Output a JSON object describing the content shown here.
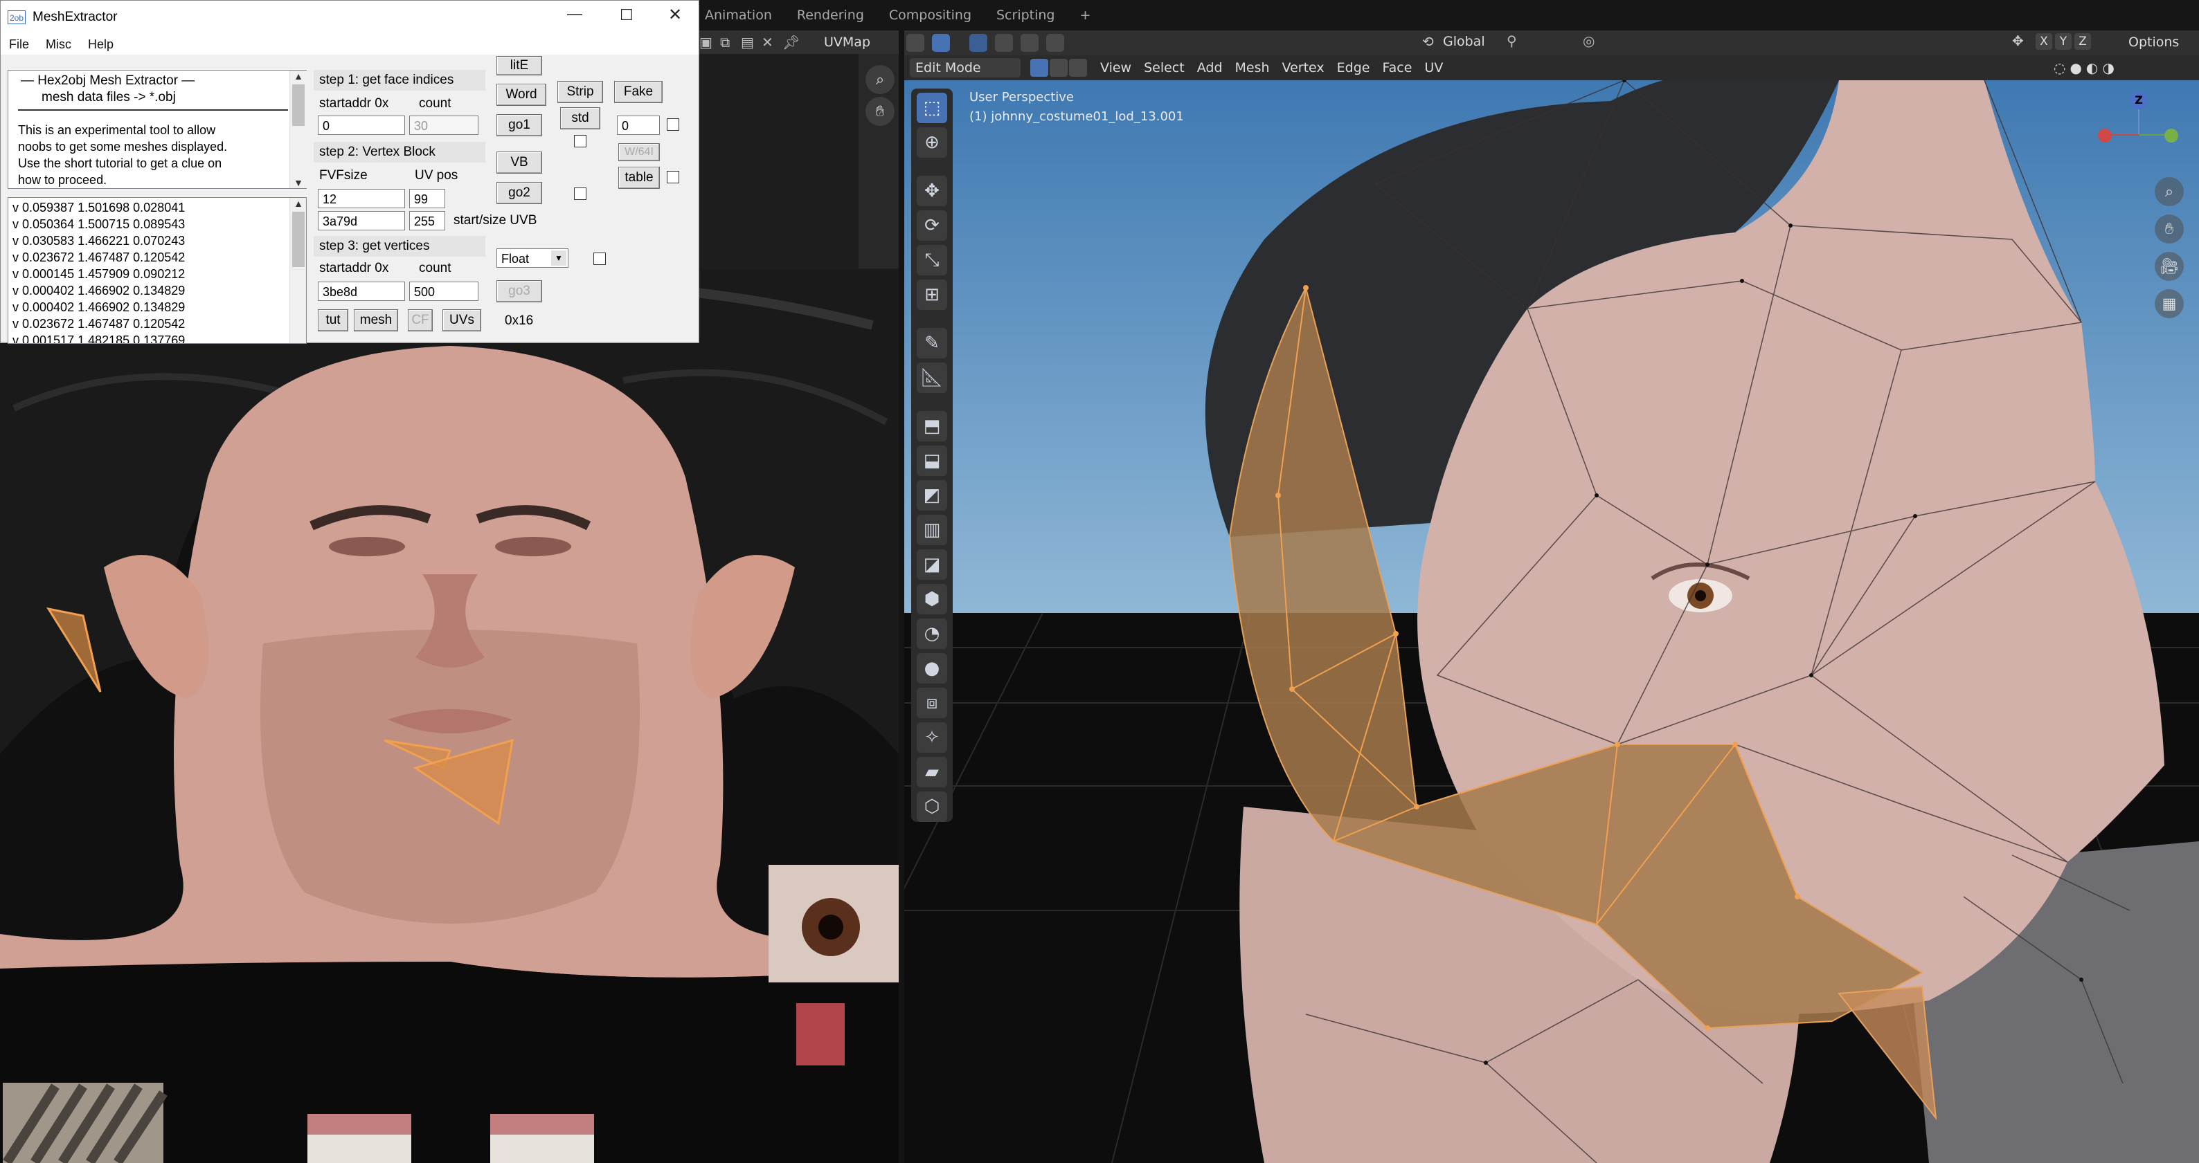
{
  "blender": {
    "workspace_tabs": [
      "Animation",
      "Rendering",
      "Compositing",
      "Scripting"
    ],
    "add_tab": "+",
    "uv_editor": {
      "uvmap_label": "UVMap"
    },
    "viewport": {
      "mode": "Edit Mode",
      "menus": [
        "View",
        "Select",
        "Add",
        "Mesh",
        "Vertex",
        "Edge",
        "Face",
        "UV"
      ],
      "orientation": "Global",
      "options_label": "Options",
      "axes": [
        "X",
        "Y",
        "Z"
      ],
      "overlay_title": "User Perspective",
      "overlay_object": "(1) johnny_costume01_lod_13.001",
      "gizmo_label": "Z"
    },
    "colors": {
      "selection": "#d99a4e",
      "active_tool": "#4772b3",
      "sky": "#4e85b8"
    }
  },
  "extractor": {
    "title": "MeshExtractor",
    "app_icon": "2ob",
    "menu": [
      "File",
      "Misc",
      "Help"
    ],
    "info_text": {
      "line1": "—   Hex2obj Mesh Extractor   —",
      "line2": "mesh data files -> *.obj",
      "line3": "This is an experimental tool to allow",
      "line4": "noobs to get some meshes displayed.",
      "line5": "Use the short tutorial to get a clue on",
      "line6": "how to proceed."
    },
    "vertices": [
      "v 0.059387 1.501698 0.028041",
      "v 0.050364 1.500715 0.089543",
      "v 0.030583 1.466221 0.070243",
      "v 0.023672 1.467487 0.120542",
      "v 0.000145 1.457909 0.090212",
      "v 0.000402 1.466902 0.134829",
      "v 0.000402 1.466902 0.134829",
      "v 0.023672 1.467487 0.120542",
      "v 0.001517 1.482185 0.137769"
    ],
    "step1": {
      "title": "step 1: get face indices",
      "startaddr_label": "startaddr 0x",
      "count_label": "count",
      "startaddr": "0",
      "count": "30"
    },
    "step2": {
      "title": "step 2: Vertex Block",
      "fvf_label": "FVFsize",
      "uvpos_label": "UV pos",
      "fvf": "12",
      "uvpos": "99",
      "addr": "3a79d",
      "size": "255",
      "startsize_label": "start/size UVB"
    },
    "step3": {
      "title": "step 3: get vertices",
      "startaddr_label": "startaddr 0x",
      "count_label": "count",
      "startaddr": "3be8d",
      "count": "500"
    },
    "buttons": {
      "lite": "litE",
      "word": "Word",
      "strip": "Strip",
      "fake": "Fake",
      "std": "std",
      "go1": "go1",
      "vb": "VB",
      "w64": "W/64I",
      "table": "table",
      "go2": "go2",
      "go3": "go3",
      "tut": "tut",
      "mesh": "mesh",
      "cf": "CF",
      "uvs": "UVs"
    },
    "fake_value": "0",
    "float_select": "Float",
    "hex_label": "0x16"
  }
}
